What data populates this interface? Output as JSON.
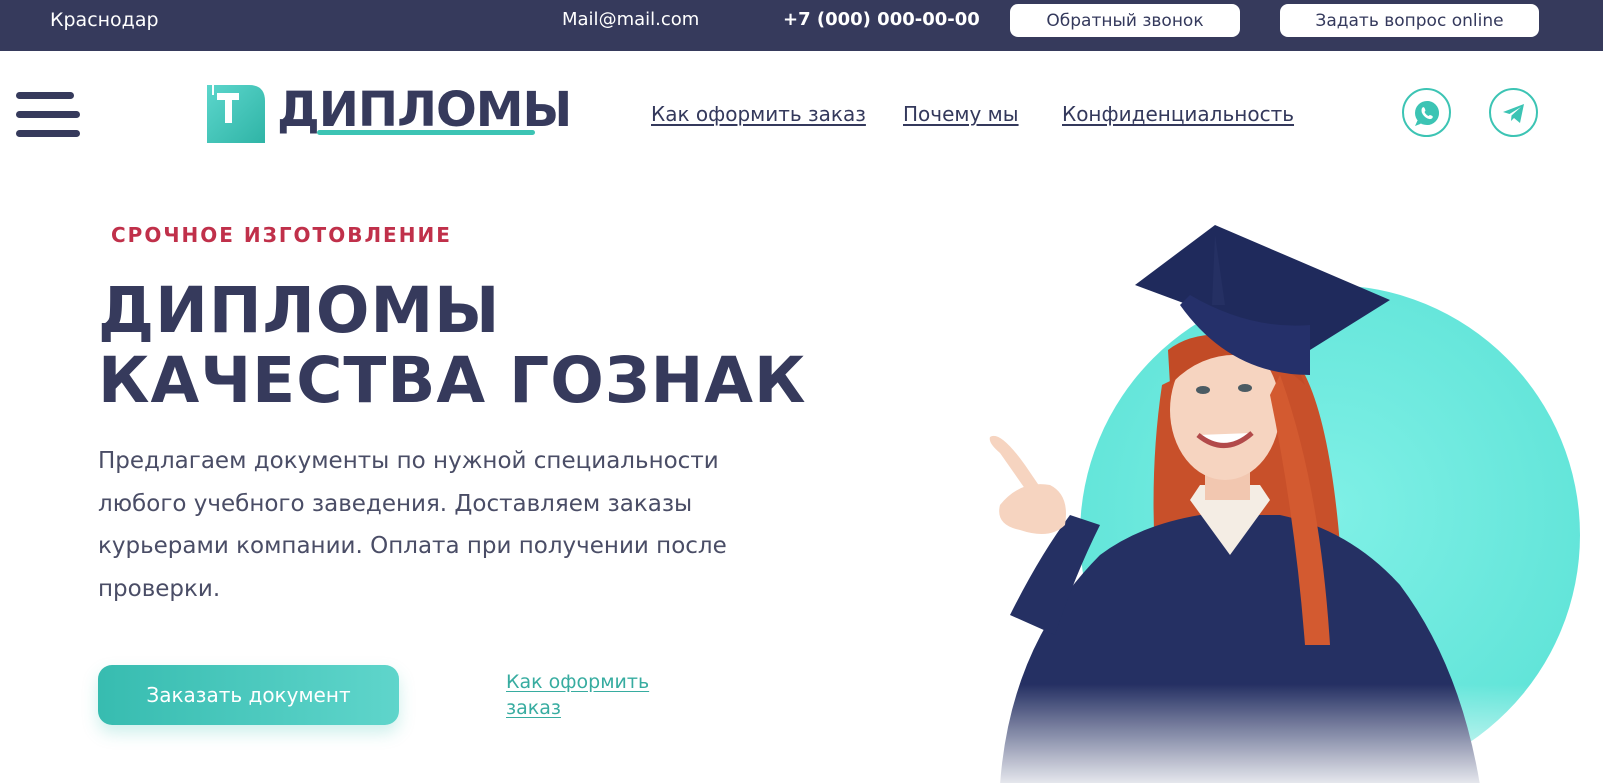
{
  "topbar": {
    "city": "Краснодар",
    "email": "Mail@mail.com",
    "phone": "+7 (000) 000-00-00",
    "callback_label": "Обратный звонок",
    "ask_label": "Задать вопрос online"
  },
  "header": {
    "logo_text": "ДИПЛОМЫ",
    "nav": [
      {
        "label": "Как оформить заказ"
      },
      {
        "label": "Почему мы"
      },
      {
        "label": "Конфиденциальность"
      }
    ],
    "social": [
      {
        "icon": "whatsapp-icon"
      },
      {
        "icon": "telegram-icon"
      }
    ]
  },
  "hero": {
    "eyebrow": "СРОЧНОЕ ИЗГОТОВЛЕНИЕ",
    "title_line1": "ДИПЛОМЫ",
    "title_line2": "КАЧЕСТВА ГОЗНАК",
    "description_lines": [
      "Предлагаем документы по нужной специальности",
      "любого учебного заведения. Доставляем заказы",
      "курьерами компании. Оплата при получении после",
      "проверки."
    ],
    "cta_label": "Заказать документ",
    "howto_line1": "Как оформить",
    "howto_line2": "заказ"
  },
  "colors": {
    "navy": "#363a5c",
    "accent": "#3cc4b4",
    "eyebrow": "#c0304a"
  }
}
